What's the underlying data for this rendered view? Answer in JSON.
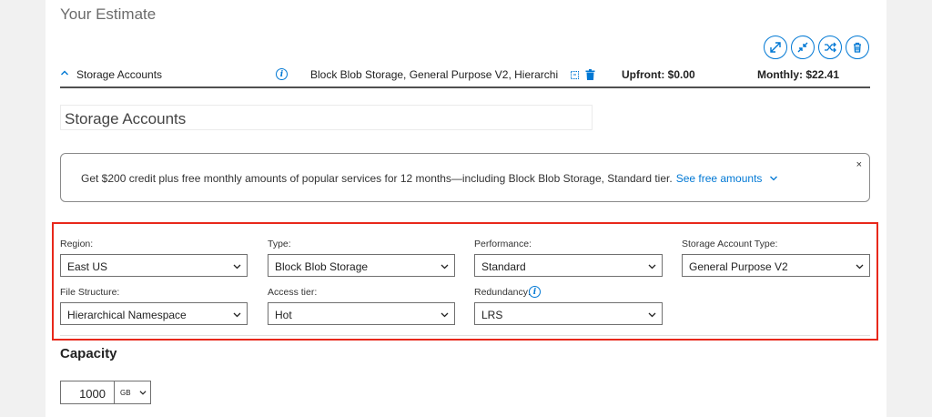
{
  "page_title": "Your Estimate",
  "estimate_row": {
    "service": "Storage Accounts",
    "description": "Block Blob Storage, General Purpose V2, Hierarchic...",
    "upfront": "Upfront: $0.00",
    "monthly": "Monthly: $22.41"
  },
  "section_name": "Storage Accounts",
  "banner": {
    "text": "Get $200 credit plus free monthly amounts of popular services for 12 months—including Block Blob Storage, Standard tier.",
    "link": "See free amounts",
    "close": "×"
  },
  "fields": {
    "region": {
      "label": "Region:",
      "value": "East US"
    },
    "type": {
      "label": "Type:",
      "value": "Block Blob Storage"
    },
    "performance": {
      "label": "Performance:",
      "value": "Standard"
    },
    "account_type": {
      "label": "Storage Account Type:",
      "value": "General Purpose V2"
    },
    "file_structure": {
      "label": "File Structure:",
      "value": "Hierarchical Namespace"
    },
    "access_tier": {
      "label": "Access tier:",
      "value": "Hot"
    },
    "redundancy": {
      "label": "Redundancy:",
      "value": "LRS"
    }
  },
  "capacity": {
    "title": "Capacity",
    "value": "1000",
    "unit": "GB"
  },
  "colors": {
    "accent": "#0078d4",
    "highlight_border": "#e8281b"
  }
}
